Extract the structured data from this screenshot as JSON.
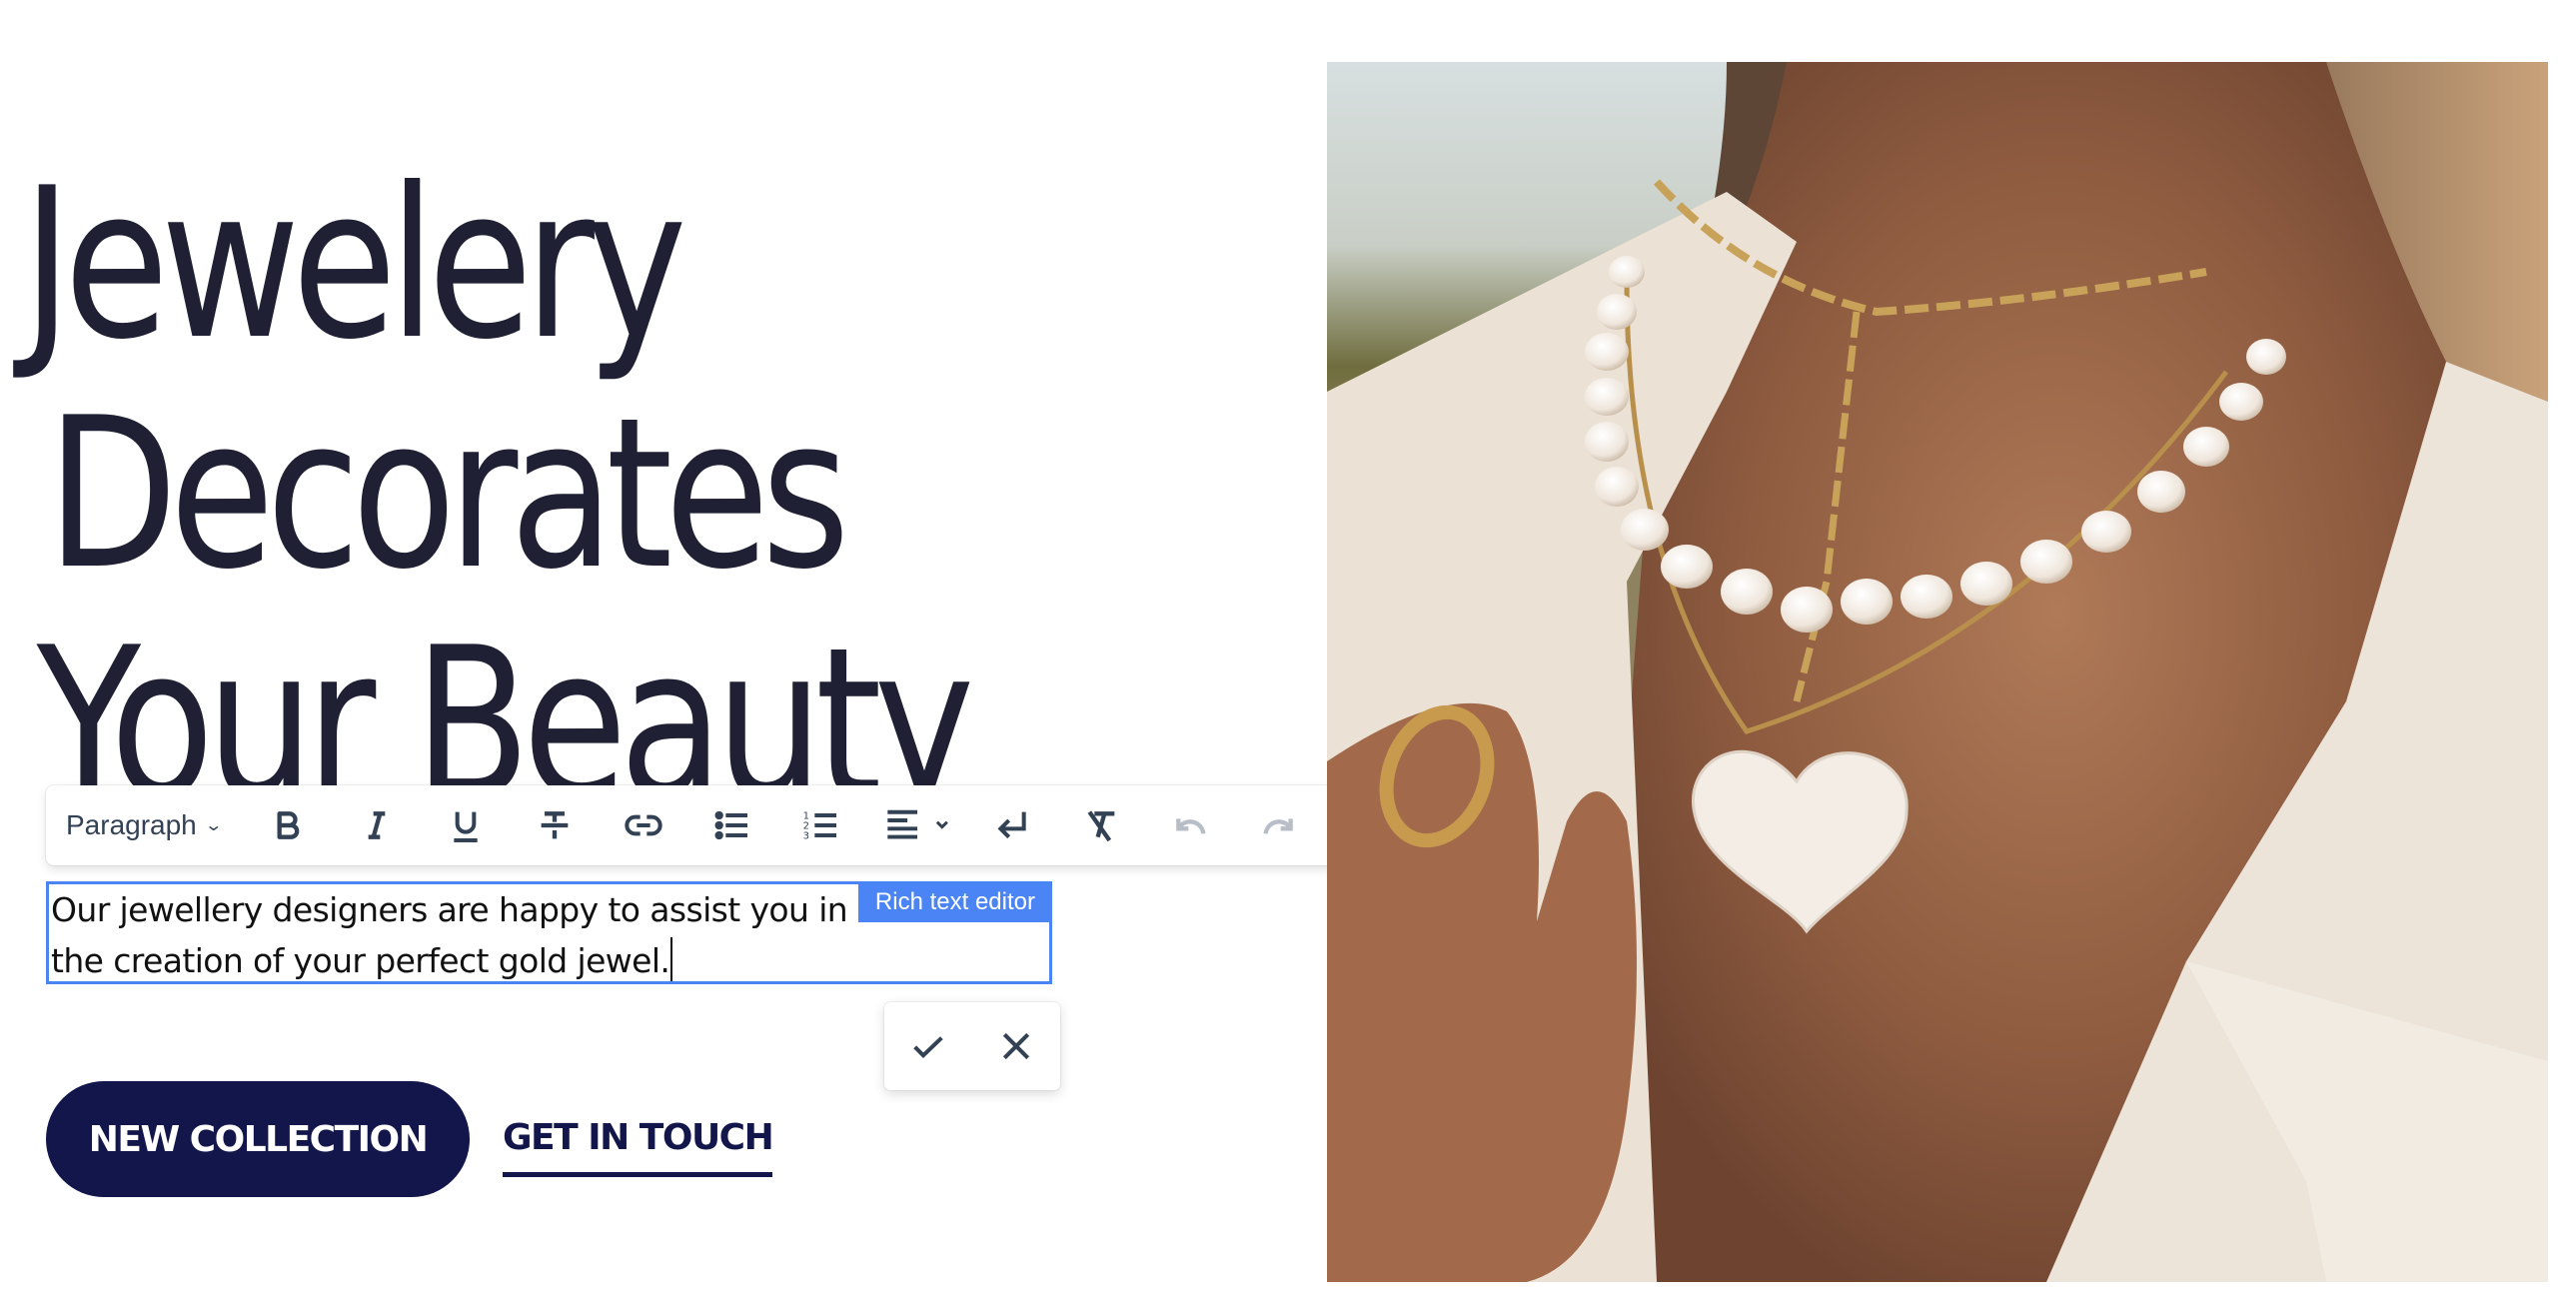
{
  "hero": {
    "title_lines": [
      "Jewelery",
      "Decorates",
      "Your Beauty"
    ]
  },
  "toolbar": {
    "block_format": "Paragraph",
    "buttons": [
      {
        "name": "bold",
        "icon": "bold-icon",
        "enabled": true
      },
      {
        "name": "italic",
        "icon": "italic-icon",
        "enabled": true
      },
      {
        "name": "underline",
        "icon": "underline-icon",
        "enabled": true
      },
      {
        "name": "strikethrough",
        "icon": "strikethrough-icon",
        "enabled": true
      },
      {
        "name": "link",
        "icon": "link-icon",
        "enabled": true
      },
      {
        "name": "bullet-list",
        "icon": "bullet-list-icon",
        "enabled": true
      },
      {
        "name": "numbered-list",
        "icon": "numbered-list-icon",
        "enabled": true
      },
      {
        "name": "align",
        "icon": "align-left-icon",
        "enabled": true,
        "dropdown": true
      },
      {
        "name": "line-break",
        "icon": "line-break-icon",
        "enabled": true
      },
      {
        "name": "clear-formatting",
        "icon": "clear-formatting-icon",
        "enabled": true
      },
      {
        "name": "undo",
        "icon": "undo-icon",
        "enabled": false
      },
      {
        "name": "redo",
        "icon": "redo-icon",
        "enabled": false
      }
    ]
  },
  "editor": {
    "text": "Our jewellery designers are happy to assist you in\nthe creation of your perfect gold jewel.",
    "tag_label": "Rich text editor"
  },
  "confirm": {
    "accept_icon": "check-icon",
    "cancel_icon": "close-icon"
  },
  "cta": {
    "primary_label": "NEW COLLECTION",
    "secondary_label": "GET IN TOUCH"
  },
  "image": {
    "description": "Woman wearing layered gold chain and pearl necklaces with a mother-of-pearl heart pendant and a gold ring"
  },
  "colors": {
    "heading": "#1f2033",
    "brand_navy": "#13164a",
    "editor_accent": "#4a84f5",
    "toolbar_icon": "#334155",
    "toolbar_icon_disabled": "#b8bec8"
  }
}
